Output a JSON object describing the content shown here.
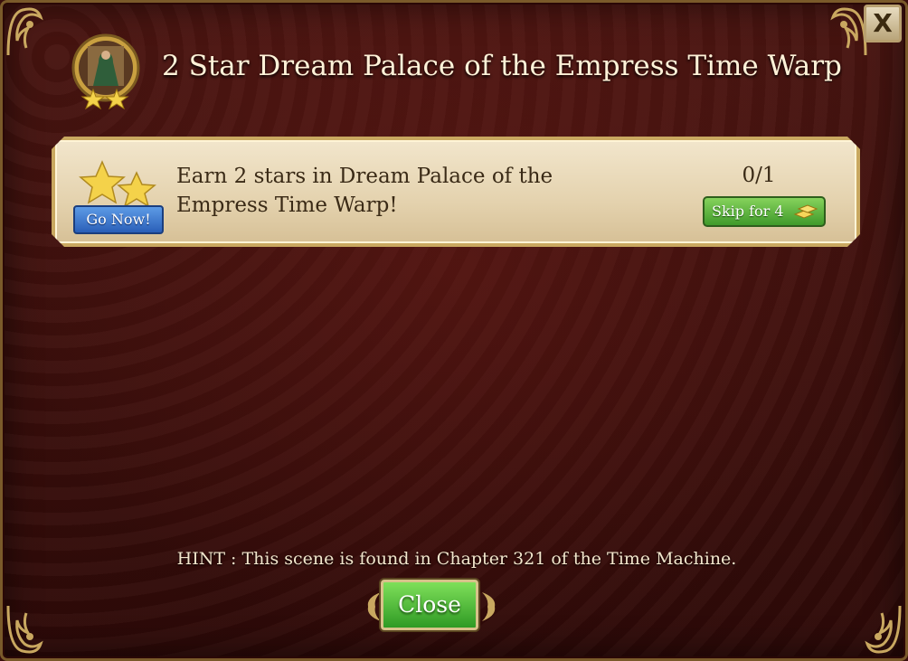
{
  "dialog": {
    "title": "2 Star Dream Palace of the Empress Time Warp",
    "close_icon_label": "X"
  },
  "task": {
    "description": "Earn 2 stars in Dream Palace of the Empress Time Warp!",
    "progress": "0/1",
    "go_now_label": "Go Now!",
    "skip_label": "Skip for 4",
    "skip_cost": 4
  },
  "footer": {
    "hint": "HINT : This scene is found in Chapter 321 of the Time Machine.",
    "close_label": "Close"
  },
  "icons": {
    "badge": "scene-portrait-badge-icon",
    "stars": "two-stars-icon",
    "currency": "gold-bars-icon"
  },
  "colors": {
    "background": "#3a0f0c",
    "go_button": "#2a5fb8",
    "skip_button": "#3f9a2a",
    "close_button": "#2f9a24",
    "text_light": "#fff2d8",
    "text_dark": "#3a2a16"
  }
}
